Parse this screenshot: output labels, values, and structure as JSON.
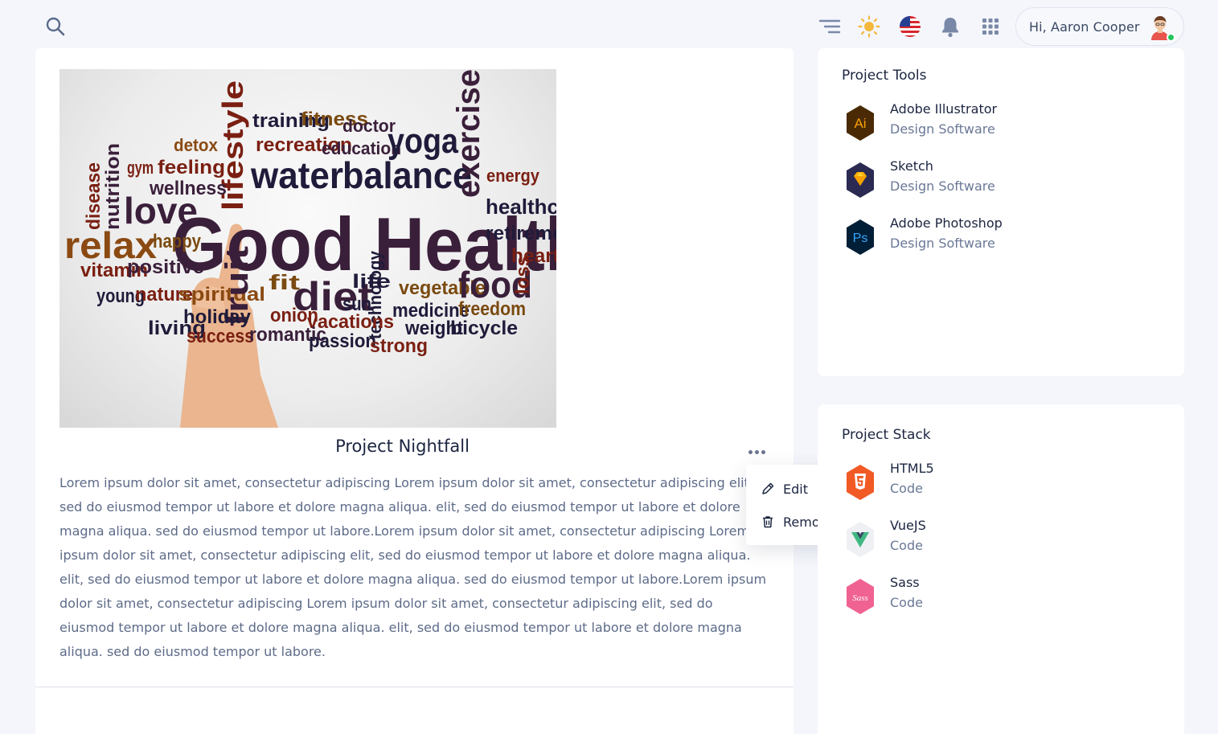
{
  "header": {
    "search_icon": "search-icon",
    "icons": [
      "menu-lines-icon",
      "sun-icon",
      "us-flag-icon",
      "bell-icon",
      "apps-grid-icon"
    ],
    "user_greeting": "Hi, Aaron Cooper",
    "accent_colors": {
      "sun": "#f5b83d",
      "online": "#22c55e"
    }
  },
  "project": {
    "title": "Project Nightfall",
    "image_words": [
      "training",
      "fitness",
      "doctor",
      "detox",
      "recreation",
      "education",
      "yoga",
      "gym",
      "feeling",
      "lifestyle",
      "water",
      "balance",
      "exercise",
      "energy",
      "wellness",
      "disease",
      "nutrition",
      "love",
      "Good Health",
      "healthcare",
      "relax",
      "happy",
      "retirement",
      "heart",
      "vitamin",
      "positive",
      "fit",
      "diet",
      "life",
      "vegetable",
      "food",
      "loss",
      "young",
      "nature",
      "spiritual",
      "fruit",
      "sun",
      "technology",
      "medicine",
      "freedom",
      "living",
      "holiday",
      "onion",
      "vacations",
      "weight",
      "bicycle",
      "success",
      "romantic",
      "passion",
      "strong"
    ],
    "description": "Lorem ipsum dolor sit amet, consectetur adipiscing Lorem ipsum dolor sit amet, consectetur adipiscing elit, sed do eiusmod tempor ut labore et dolore magna aliqua. elit, sed do eiusmod tempor ut labore et dolore magna aliqua. sed do eiusmod tempor ut labore.Lorem ipsum dolor sit amet, consectetur adipiscing Lorem ipsum dolor sit amet, consectetur adipiscing elit, sed do eiusmod tempor ut labore et dolore magna aliqua. elit, sed do eiusmod tempor ut labore et dolore magna aliqua. sed do eiusmod tempor ut labore.Lorem ipsum dolor sit amet, consectetur adipiscing Lorem ipsum dolor sit amet, consectetur adipiscing elit, sed do eiusmod tempor ut labore et dolore magna aliqua. elit, sed do eiusmod tempor ut labore et dolore magna aliqua. sed do eiusmod tempor ut labore.",
    "menu": {
      "edit_label": "Edit",
      "remove_label": "Remove"
    }
  },
  "tools": {
    "title": "Project Tools",
    "items": [
      {
        "name": "Adobe Illustrator",
        "category": "Design Software",
        "icon": "adobe-illustrator-icon",
        "color": "#f7a100"
      },
      {
        "name": "Sketch",
        "category": "Design Software",
        "icon": "sketch-icon",
        "color": "#fdb300"
      },
      {
        "name": "Adobe Photoshop",
        "category": "Design Software",
        "icon": "adobe-photoshop-icon",
        "color": "#31a8ff"
      }
    ]
  },
  "stack": {
    "title": "Project Stack",
    "items": [
      {
        "name": "HTML5",
        "category": "Code",
        "icon": "html5-icon",
        "color": "#f15a24"
      },
      {
        "name": "VueJS",
        "category": "Code",
        "icon": "vuejs-icon",
        "color": "#41b883"
      },
      {
        "name": "Sass",
        "category": "Code",
        "icon": "sass-icon",
        "color": "#f06292"
      }
    ]
  }
}
